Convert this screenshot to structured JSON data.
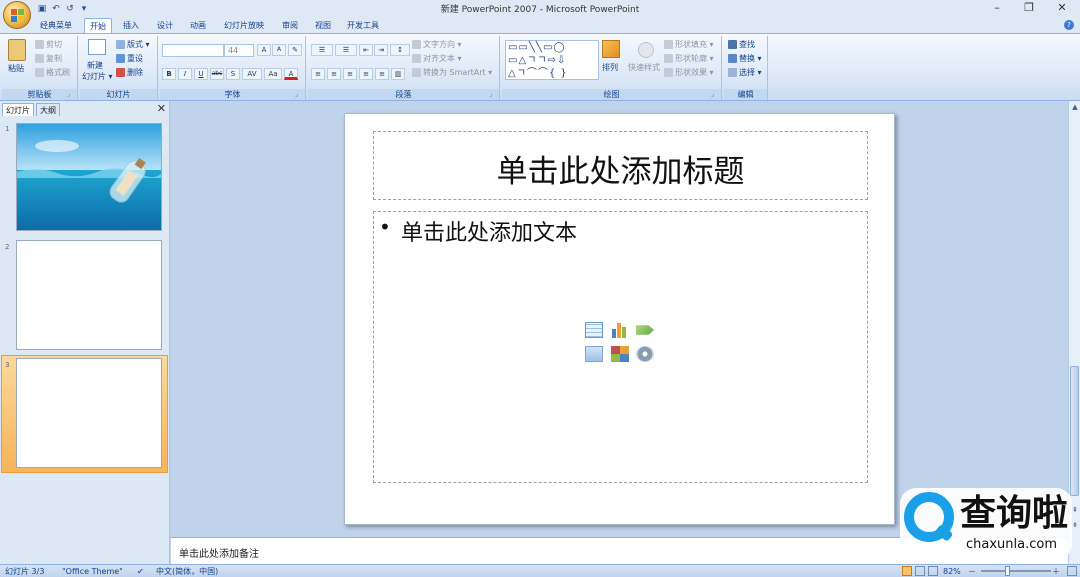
{
  "window": {
    "title": "新建 PowerPoint 2007 - Microsoft PowerPoint",
    "controls": {
      "minimize": "–",
      "restore": "❐",
      "close": "✕"
    }
  },
  "quick_access": {
    "save": "▣",
    "undo": "↶",
    "redo": "↺",
    "customize": "▾"
  },
  "ribbon_tabs": [
    "经典菜单",
    "开始",
    "插入",
    "设计",
    "动画",
    "幻灯片放映",
    "审阅",
    "视图",
    "开发工具"
  ],
  "active_tab": "开始",
  "ribbon": {
    "clipboard": {
      "label": "剪贴板",
      "paste": "粘贴",
      "cut": "剪切",
      "copy": "复制",
      "format_painter": "格式刷"
    },
    "slides": {
      "label": "幻灯片",
      "new_slide": "新建",
      "new_slide_2": "幻灯片 ▾",
      "layout": "版式 ▾",
      "reset": "重设",
      "delete": "删除"
    },
    "font": {
      "label": "字体",
      "font_name": "",
      "font_size": "44",
      "grow": "A",
      "shrink": "A",
      "clear": "✎",
      "bold": "B",
      "italic": "I",
      "underline": "U",
      "strike": "abc",
      "shadow": "S",
      "spacing": "AV",
      "case": "Aa",
      "color": "A"
    },
    "paragraph": {
      "label": "段落",
      "text_direction": "文字方向 ▾",
      "align_text": "对齐文本 ▾",
      "smartart": "转换为 SmartArt ▾"
    },
    "drawing": {
      "label": "绘图",
      "arrange": "排列",
      "quick_styles": "快速样式",
      "shape_fill": "形状填充 ▾",
      "shape_outline": "形状轮廓 ▾",
      "shape_effects": "形状效果 ▾"
    },
    "editing": {
      "label": "编辑",
      "find": "查找",
      "replace": "替换 ▾",
      "select": "选择 ▾"
    }
  },
  "panel": {
    "tabs": [
      "幻灯片",
      "大纲"
    ],
    "close": "✕",
    "slide_numbers": [
      "1",
      "2",
      "3"
    ],
    "selected_slide": 3
  },
  "slide": {
    "title_placeholder": "单击此处添加标题",
    "bullet": "•",
    "body_placeholder": "单击此处添加文本"
  },
  "notes": {
    "placeholder": "单击此处添加备注"
  },
  "status": {
    "slide_counter": "幻灯片 3/3",
    "theme": "\"Office Theme\"",
    "language": "中文(简体，中国)",
    "zoom": "82%",
    "zoom_out": "－",
    "zoom_in": "＋"
  },
  "watermark": {
    "name": "查询啦",
    "domain": "chaxunla.com"
  },
  "colors": {
    "ribbon_bg": "#dbe7f6",
    "accent": "#15428b",
    "selection": "#f7b45a",
    "office_orange": "#f3c25a",
    "watermark_blue": "#1aa0e8"
  }
}
